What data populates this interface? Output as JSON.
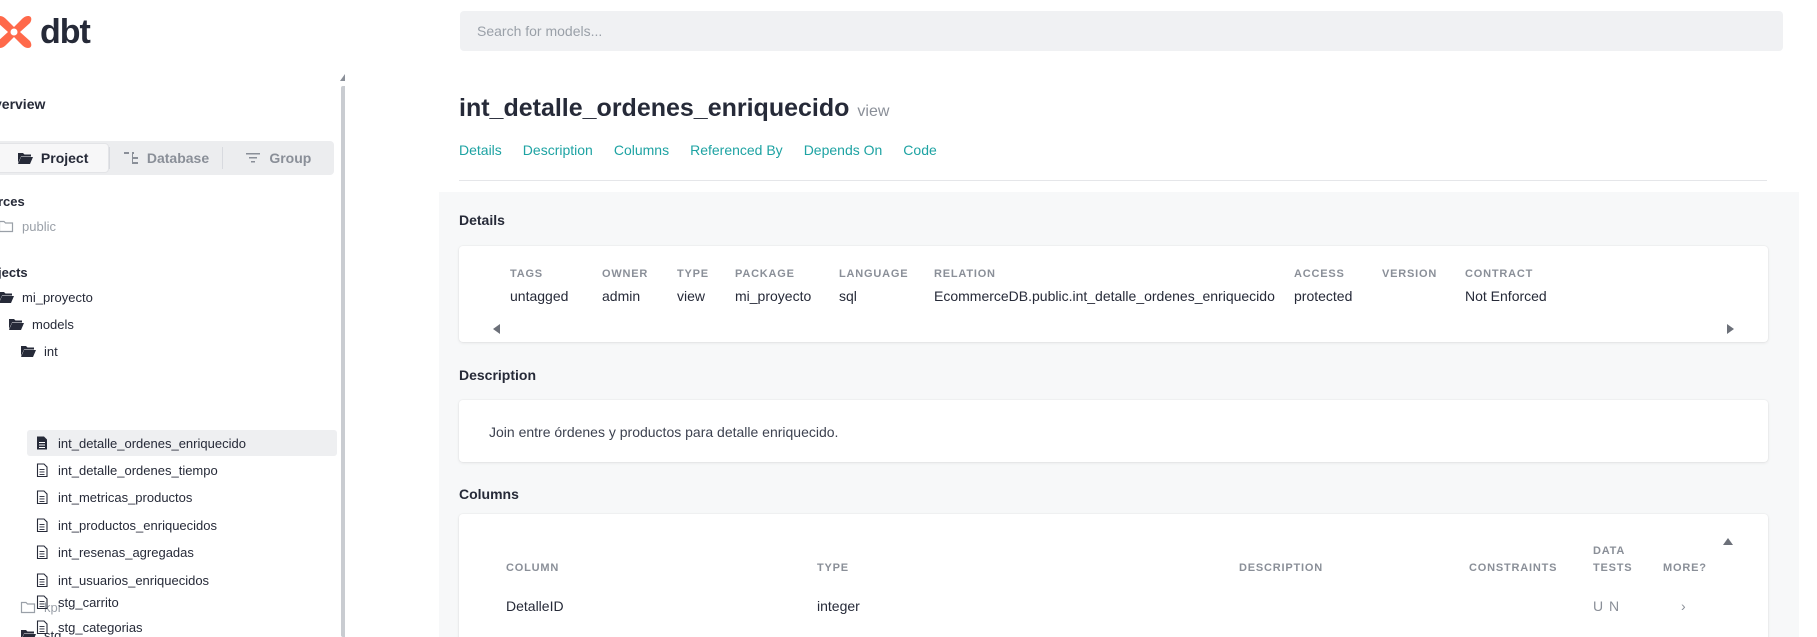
{
  "app": {
    "logo_text": "dbt",
    "brand_color": "#ff694a",
    "accent_color": "#1ea3a3"
  },
  "search": {
    "placeholder": "Search for models..."
  },
  "sidebar": {
    "overview_label": "verview",
    "tabs": [
      {
        "label": "Project",
        "icon": "folder-open-icon",
        "active": true
      },
      {
        "label": "Database",
        "icon": "database-tree-icon",
        "active": false
      },
      {
        "label": "Group",
        "icon": "filter-lines-icon",
        "active": false
      }
    ],
    "sources_label": "rces",
    "sources": [
      {
        "label": "public",
        "icon": "folder-icon"
      }
    ],
    "projects_label": "jects",
    "tree": [
      {
        "label": "mi_proyecto",
        "icon": "folder-open-icon"
      },
      {
        "label": "models",
        "icon": "folder-open-icon"
      },
      {
        "label": "int",
        "icon": "folder-open-icon"
      },
      {
        "label": "int_detalle_ordenes_enriquecido",
        "icon": "file-icon",
        "selected": true
      },
      {
        "label": "int_detalle_ordenes_tiempo",
        "icon": "file-icon"
      },
      {
        "label": "int_metricas_productos",
        "icon": "file-icon"
      },
      {
        "label": "int_productos_enriquecidos",
        "icon": "file-icon"
      },
      {
        "label": "int_resenas_agregadas",
        "icon": "file-icon"
      },
      {
        "label": "int_usuarios_enriquecidos",
        "icon": "file-icon"
      },
      {
        "label": "kpi",
        "icon": "folder-icon"
      },
      {
        "label": "stg",
        "icon": "folder-open-icon"
      },
      {
        "label": "stg_carrito",
        "icon": "file-icon"
      },
      {
        "label": "stg_categorias",
        "icon": "file-icon"
      }
    ]
  },
  "main": {
    "title": "int_detalle_ordenes_enriquecido",
    "kind": "view",
    "subnav": [
      "Details",
      "Description",
      "Columns",
      "Referenced By",
      "Depends On",
      "Code"
    ],
    "details_heading": "Details",
    "details": [
      {
        "key": "TAGS",
        "value": "untagged"
      },
      {
        "key": "OWNER",
        "value": "admin"
      },
      {
        "key": "TYPE",
        "value": "view"
      },
      {
        "key": "PACKAGE",
        "value": "mi_proyecto"
      },
      {
        "key": "LANGUAGE",
        "value": "sql"
      },
      {
        "key": "RELATION",
        "value": "EcommerceDB.public.int_detalle_ordenes_enriquecido"
      },
      {
        "key": "ACCESS",
        "value": "protected"
      },
      {
        "key": "VERSION",
        "value": ""
      },
      {
        "key": "CONTRACT",
        "value": "Not Enforced"
      }
    ],
    "description_heading": "Description",
    "description_text": "Join entre órdenes y productos para detalle enriquecido.",
    "columns_heading": "Columns",
    "columns_table": {
      "headers": {
        "column": "COLUMN",
        "type": "TYPE",
        "description": "DESCRIPTION",
        "constraints": "CONSTRAINTS",
        "data_tests_1": "DATA",
        "data_tests_2": "TESTS",
        "more": "MORE?"
      },
      "rows": [
        {
          "column": "DetalleID",
          "type": "integer",
          "description": "",
          "constraints": "",
          "tests": "U N",
          "more": "›"
        }
      ]
    }
  }
}
